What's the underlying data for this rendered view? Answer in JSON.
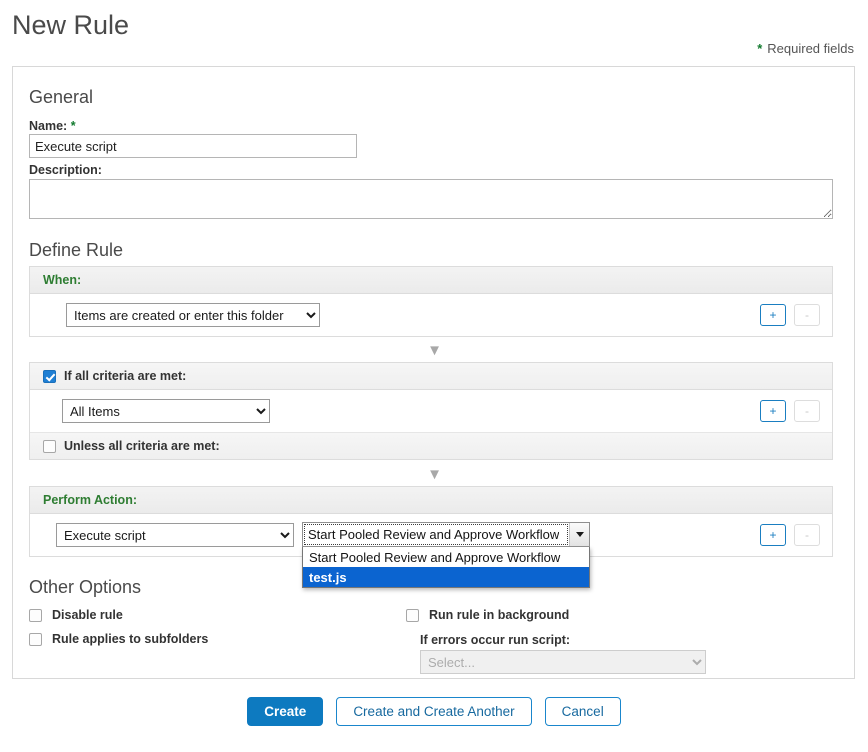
{
  "header": {
    "title": "New Rule",
    "required_star": "*",
    "required_text": "Required fields"
  },
  "general": {
    "heading": "General",
    "name_label": "Name:",
    "name_star": "*",
    "name_value": "Execute script",
    "name_placeholder": "",
    "description_label": "Description:",
    "description_value": "",
    "description_placeholder": ""
  },
  "define_rule": {
    "heading": "Define Rule",
    "when": {
      "label": "When:",
      "selected": "Items are created or enter this folder",
      "options": [
        "Items are created or enter this folder"
      ],
      "add_label": "+",
      "remove_label": "-"
    },
    "separator_icon": "▼",
    "criteria": {
      "if_label": "If all criteria are met:",
      "if_checked": true,
      "selected": "All Items",
      "options": [
        "All Items"
      ],
      "unless_label": "Unless all criteria are met:",
      "unless_checked": false,
      "add_label": "+",
      "remove_label": "-"
    },
    "action": {
      "label": "Perform Action:",
      "selected": "Execute script",
      "options": [
        "Execute script"
      ],
      "add_label": "+",
      "remove_label": "-",
      "script_dropdown": {
        "selected": "Start Pooled Review and Approve Workflow",
        "open": true,
        "options": [
          "Start Pooled Review and Approve Workflow",
          "test.js"
        ],
        "highlighted_index": 1
      }
    }
  },
  "other_options": {
    "heading": "Other Options",
    "disable_rule_label": "Disable rule",
    "disable_rule_checked": false,
    "subfolders_label": "Rule applies to subfolders",
    "subfolders_checked": false,
    "background_label": "Run rule in background",
    "background_checked": false,
    "error_script_label": "If errors occur run script:",
    "error_script_selected": "Select...",
    "error_script_options": [
      "Select..."
    ],
    "error_script_disabled": true
  },
  "footer": {
    "create_label": "Create",
    "create_another_label": "Create and Create Another",
    "cancel_label": "Cancel"
  },
  "colors": {
    "accent_blue": "#0d7ac0",
    "label_green": "#2e7d32",
    "required_green": "#117a2e",
    "highlight_blue": "#0b64d0"
  }
}
